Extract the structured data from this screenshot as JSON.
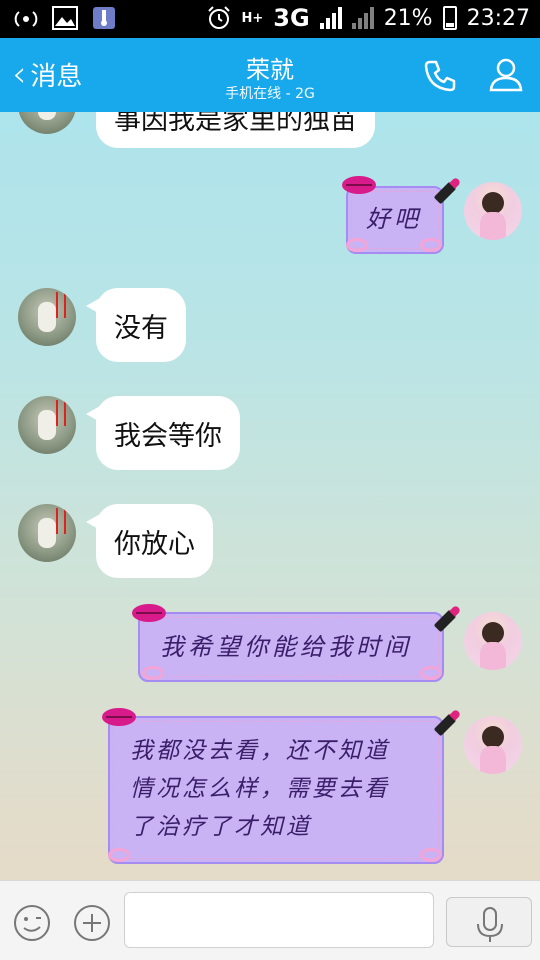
{
  "status_bar": {
    "network": "3G",
    "signal_label": "H+",
    "battery": "21%",
    "time": "23:27"
  },
  "header": {
    "back_label": "消息",
    "title": "荣就",
    "subtitle": "手机在线 - 2G",
    "phone_icon": "phone-icon",
    "profile_icon": "profile-icon"
  },
  "messages": [
    {
      "side": "in",
      "text": "事因我是家里的独苗"
    },
    {
      "side": "out",
      "text": "好吧"
    },
    {
      "side": "in",
      "text": "没有"
    },
    {
      "side": "in",
      "text": "我会等你"
    },
    {
      "side": "in",
      "text": "你放心"
    },
    {
      "side": "out",
      "text": "我希望你能给我时间"
    },
    {
      "side": "out",
      "lines": [
        "我都没去看，还不知道",
        "情况怎么样，需要去看",
        "了治疗了才知道"
      ]
    }
  ],
  "input": {
    "emoji_icon": "emoji-icon",
    "plus_icon": "plus-icon",
    "mic_icon": "mic-icon",
    "placeholder": ""
  },
  "colors": {
    "header_bg": "#18a8ec",
    "out_bubble": "#c9b3f4",
    "in_bubble": "#ffffff"
  }
}
